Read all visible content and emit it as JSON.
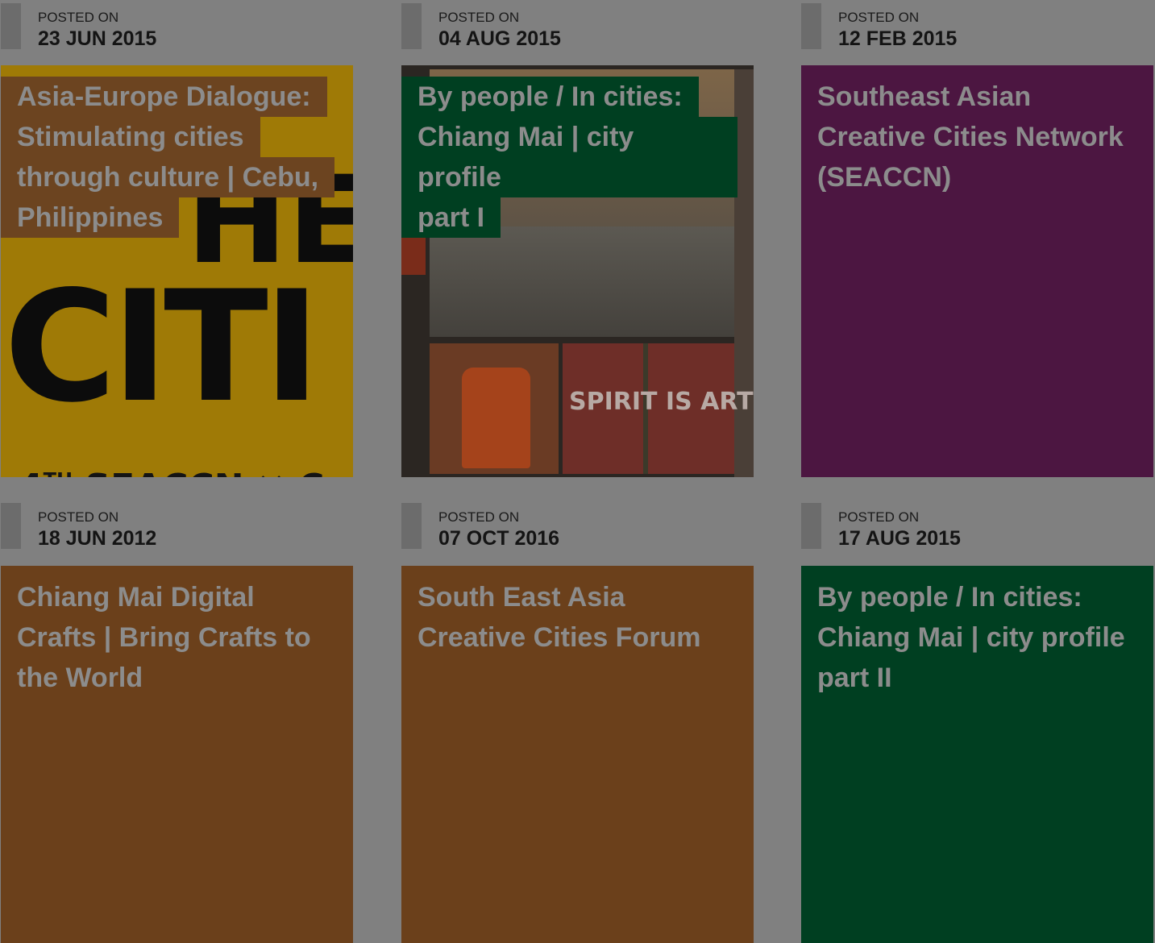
{
  "posts": [
    {
      "label": "POSTED ON",
      "date": "23 JUN 2015",
      "title_lines": [
        "Asia-Europe Dialogue:",
        "Stimulating cities",
        "through culture | Cebu,",
        "Philippines"
      ],
      "card_color": "#9f7a06",
      "title_bg": "#6c4420",
      "image_text": {
        "top": "HE",
        "big": "CITI",
        "bottom": "4",
        "bottom_sup": "TH",
        "bottom_rest": " SEACCN ✕ C"
      }
    },
    {
      "label": "POSTED ON",
      "date": "04 AUG 2015",
      "title_lines": [
        "By people / In cities:",
        "Chiang Mai | city profile",
        "part I"
      ],
      "card_color": "#2b2622",
      "title_bg": "#003f21",
      "image_text": {
        "sign": "SPIRIT IS ART"
      }
    },
    {
      "label": "POSTED ON",
      "date": "12 FEB 2015",
      "title_lines": [
        "Southeast Asian",
        "Creative Cities Network",
        "(SEACCN)"
      ],
      "card_color": "#4c1641"
    },
    {
      "label": "POSTED ON",
      "date": "18 JUN 2012",
      "title_lines": [
        "Chiang Mai Digital",
        "Crafts | Bring Crafts to",
        "the World"
      ],
      "card_color": "#6b401b"
    },
    {
      "label": "POSTED ON",
      "date": "07 OCT 2016",
      "title_lines": [
        "South East Asia",
        "Creative Cities Forum"
      ],
      "card_color": "#6b401b"
    },
    {
      "label": "POSTED ON",
      "date": "17 AUG 2015",
      "title_lines": [
        "By people / In cities:",
        "Chiang Mai | city profile",
        "part II"
      ],
      "card_color": "#003f21"
    }
  ]
}
